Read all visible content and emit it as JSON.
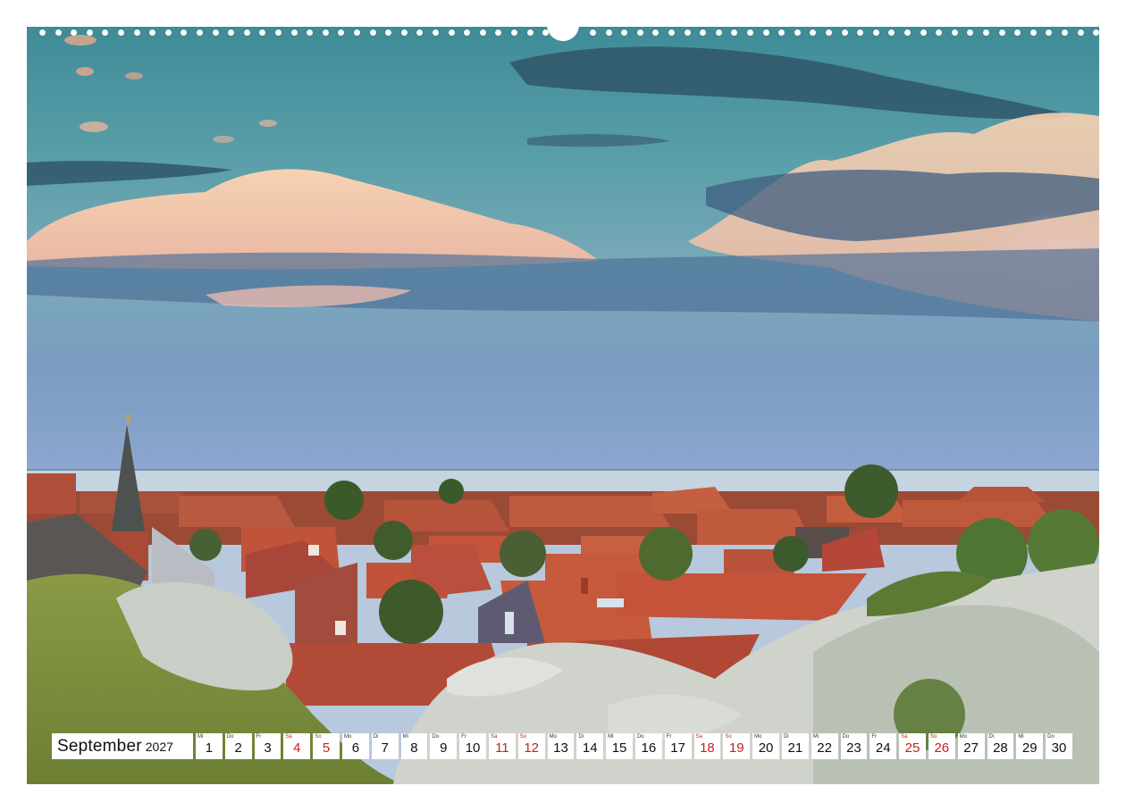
{
  "calendar": {
    "month": "September",
    "year": "2027",
    "days": [
      {
        "wd": "Mi",
        "d": "1",
        "we": false
      },
      {
        "wd": "Do",
        "d": "2",
        "we": false
      },
      {
        "wd": "Fr",
        "d": "3",
        "we": false
      },
      {
        "wd": "Sa",
        "d": "4",
        "we": true
      },
      {
        "wd": "So",
        "d": "5",
        "we": true
      },
      {
        "wd": "Mo",
        "d": "6",
        "we": false
      },
      {
        "wd": "Di",
        "d": "7",
        "we": false
      },
      {
        "wd": "Mi",
        "d": "8",
        "we": false
      },
      {
        "wd": "Do",
        "d": "9",
        "we": false
      },
      {
        "wd": "Fr",
        "d": "10",
        "we": false
      },
      {
        "wd": "Sa",
        "d": "11",
        "we": true
      },
      {
        "wd": "So",
        "d": "12",
        "we": true
      },
      {
        "wd": "Mo",
        "d": "13",
        "we": false
      },
      {
        "wd": "Di",
        "d": "14",
        "we": false
      },
      {
        "wd": "Mi",
        "d": "15",
        "we": false
      },
      {
        "wd": "Do",
        "d": "16",
        "we": false
      },
      {
        "wd": "Fr",
        "d": "17",
        "we": false
      },
      {
        "wd": "Sa",
        "d": "18",
        "we": true
      },
      {
        "wd": "So",
        "d": "19",
        "we": true
      },
      {
        "wd": "Mo",
        "d": "20",
        "we": false
      },
      {
        "wd": "Di",
        "d": "21",
        "we": false
      },
      {
        "wd": "Mi",
        "d": "22",
        "we": false
      },
      {
        "wd": "Do",
        "d": "23",
        "we": false
      },
      {
        "wd": "Fr",
        "d": "24",
        "we": false
      },
      {
        "wd": "Sa",
        "d": "25",
        "we": true
      },
      {
        "wd": "So",
        "d": "26",
        "we": true
      },
      {
        "wd": "Mo",
        "d": "27",
        "we": false
      },
      {
        "wd": "Di",
        "d": "28",
        "we": false
      },
      {
        "wd": "Mi",
        "d": "29",
        "we": false
      },
      {
        "wd": "Do",
        "d": "30",
        "we": false
      }
    ]
  },
  "colors": {
    "weekend": "#c81e1e",
    "roof": "#b4492f",
    "sea": "#c9d5e2"
  }
}
